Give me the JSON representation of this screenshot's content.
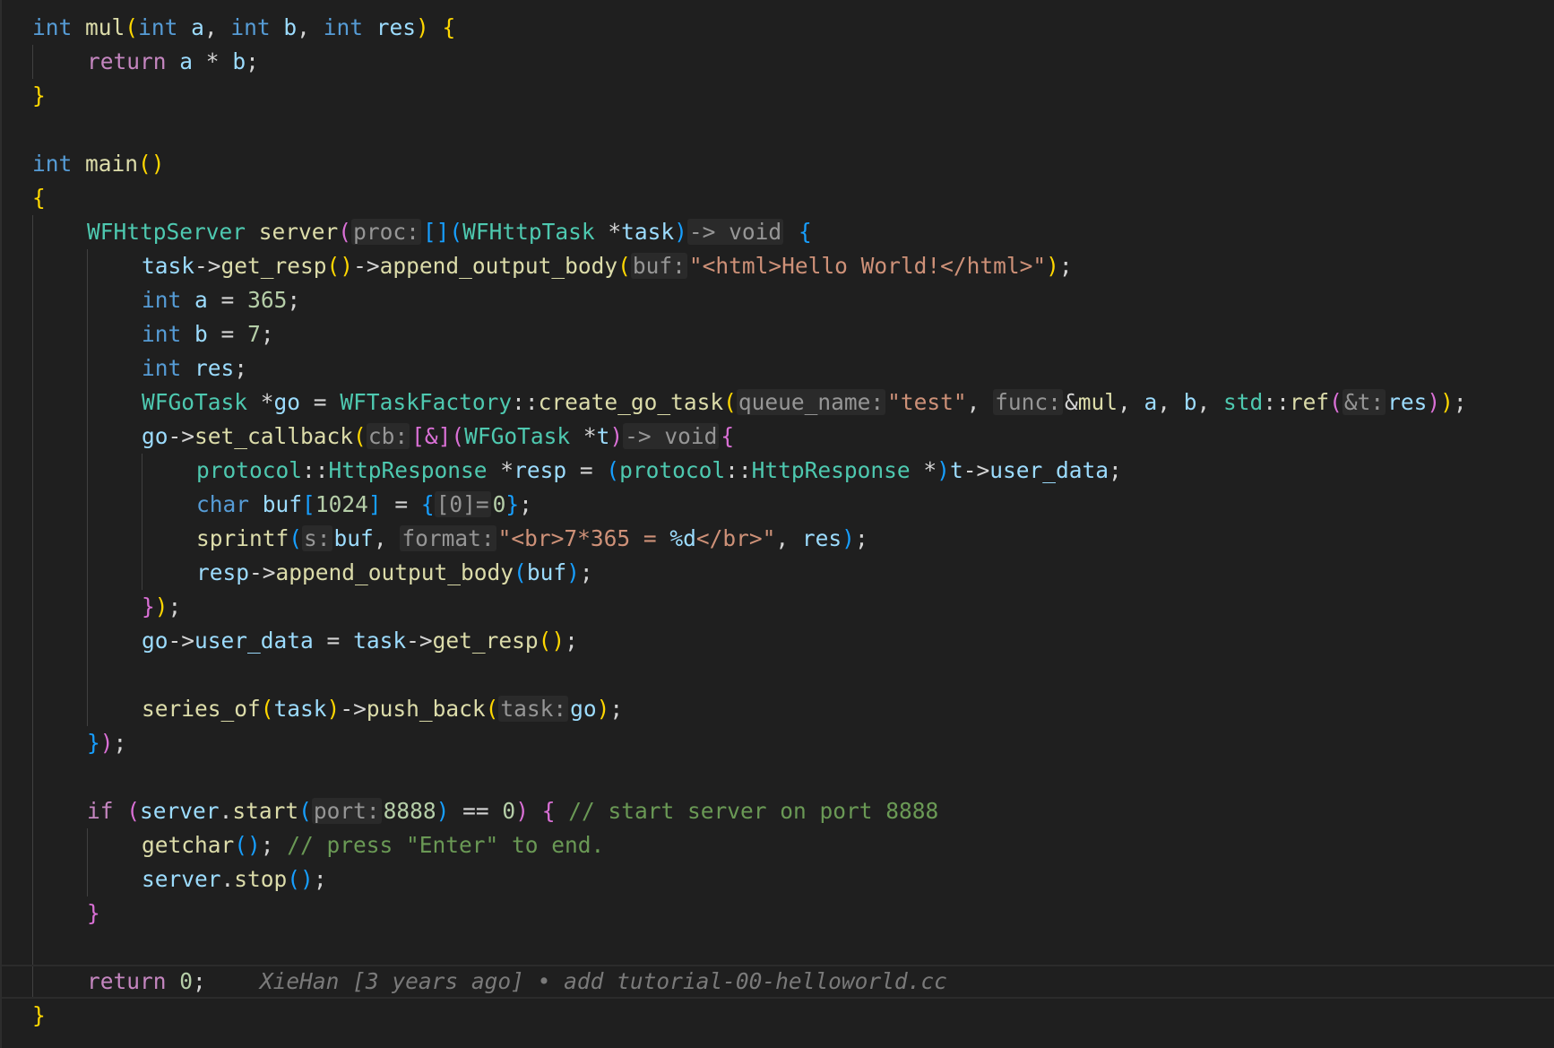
{
  "editor": {
    "language": "cpp",
    "theme_colors": {
      "background": "#1f1f1f",
      "keyword": "#569cd6",
      "control": "#c586c0",
      "function": "#dcdcaa",
      "variable": "#9cdcfe",
      "type": "#4ec9b0",
      "string": "#ce9178",
      "number": "#b5cea8",
      "comment": "#6a9955",
      "inlay_hint": "#969696"
    },
    "blame": {
      "text": "XieHan [3 years ago] • add tutorial-00-helloworld.cc",
      "line_index": 28
    },
    "lines": [
      {
        "indent": 0,
        "tokens": [
          [
            "kw",
            "int"
          ],
          [
            "op",
            " "
          ],
          [
            "fn",
            "mul"
          ],
          [
            "b1",
            "("
          ],
          [
            "kw",
            "int"
          ],
          [
            "op",
            " "
          ],
          [
            "var",
            "a"
          ],
          [
            "op",
            ", "
          ],
          [
            "kw",
            "int"
          ],
          [
            "op",
            " "
          ],
          [
            "var",
            "b"
          ],
          [
            "op",
            ", "
          ],
          [
            "kw",
            "int"
          ],
          [
            "op",
            " "
          ],
          [
            "var",
            "res"
          ],
          [
            "b1",
            ")"
          ],
          [
            "op",
            " "
          ],
          [
            "b1",
            "{"
          ]
        ]
      },
      {
        "indent": 1,
        "tokens": [
          [
            "ctl",
            "return"
          ],
          [
            "op",
            " "
          ],
          [
            "var",
            "a"
          ],
          [
            "op",
            " * "
          ],
          [
            "var",
            "b"
          ],
          [
            "op",
            ";"
          ]
        ]
      },
      {
        "indent": 0,
        "tokens": [
          [
            "b1",
            "}"
          ]
        ]
      },
      {
        "indent": 0,
        "tokens": []
      },
      {
        "indent": 0,
        "tokens": [
          [
            "kw",
            "int"
          ],
          [
            "op",
            " "
          ],
          [
            "fn",
            "main"
          ],
          [
            "b1",
            "()"
          ]
        ]
      },
      {
        "indent": 0,
        "tokens": [
          [
            "b1",
            "{"
          ]
        ]
      },
      {
        "indent": 1,
        "tokens": [
          [
            "type",
            "WFHttpServer"
          ],
          [
            "op",
            " "
          ],
          [
            "fn",
            "server"
          ],
          [
            "b2",
            "("
          ],
          [
            "hint",
            "proc:"
          ],
          [
            "b3",
            "[]("
          ],
          [
            "type",
            "WFHttpTask"
          ],
          [
            "op",
            " *"
          ],
          [
            "var",
            "task"
          ],
          [
            "b3",
            ")"
          ],
          [
            "hint",
            "-> void"
          ],
          [
            "op",
            " "
          ],
          [
            "b3",
            "{"
          ]
        ]
      },
      {
        "indent": 2,
        "tokens": [
          [
            "var",
            "task"
          ],
          [
            "op",
            "->"
          ],
          [
            "fn",
            "get_resp"
          ],
          [
            "b1",
            "()"
          ],
          [
            "op",
            "->"
          ],
          [
            "fn",
            "append_output_body"
          ],
          [
            "b1",
            "("
          ],
          [
            "hint",
            "buf:"
          ],
          [
            "str",
            "\"<html>Hello World!</html>\""
          ],
          [
            "b1",
            ")"
          ],
          [
            "op",
            ";"
          ]
        ]
      },
      {
        "indent": 2,
        "tokens": [
          [
            "kw",
            "int"
          ],
          [
            "op",
            " "
          ],
          [
            "var",
            "a"
          ],
          [
            "op",
            " = "
          ],
          [
            "num",
            "365"
          ],
          [
            "op",
            ";"
          ]
        ]
      },
      {
        "indent": 2,
        "tokens": [
          [
            "kw",
            "int"
          ],
          [
            "op",
            " "
          ],
          [
            "var",
            "b"
          ],
          [
            "op",
            " = "
          ],
          [
            "num",
            "7"
          ],
          [
            "op",
            ";"
          ]
        ]
      },
      {
        "indent": 2,
        "tokens": [
          [
            "kw",
            "int"
          ],
          [
            "op",
            " "
          ],
          [
            "var",
            "res"
          ],
          [
            "op",
            ";"
          ]
        ]
      },
      {
        "indent": 2,
        "tokens": [
          [
            "type",
            "WFGoTask"
          ],
          [
            "op",
            " *"
          ],
          [
            "var",
            "go"
          ],
          [
            "op",
            " = "
          ],
          [
            "type",
            "WFTaskFactory"
          ],
          [
            "op",
            "::"
          ],
          [
            "fn",
            "create_go_task"
          ],
          [
            "b1",
            "("
          ],
          [
            "hint",
            "queue_name:"
          ],
          [
            "str",
            "\"test\""
          ],
          [
            "op",
            ", "
          ],
          [
            "hint",
            "func:"
          ],
          [
            "op",
            "&"
          ],
          [
            "fn",
            "mul"
          ],
          [
            "op",
            ", "
          ],
          [
            "var",
            "a"
          ],
          [
            "op",
            ", "
          ],
          [
            "var",
            "b"
          ],
          [
            "op",
            ", "
          ],
          [
            "type",
            "std"
          ],
          [
            "op",
            "::"
          ],
          [
            "fn",
            "ref"
          ],
          [
            "b2",
            "("
          ],
          [
            "hint",
            "&t:"
          ],
          [
            "var",
            "res"
          ],
          [
            "b2",
            ")"
          ],
          [
            "b1",
            ")"
          ],
          [
            "op",
            ";"
          ]
        ]
      },
      {
        "indent": 2,
        "tokens": [
          [
            "var",
            "go"
          ],
          [
            "op",
            "->"
          ],
          [
            "fn",
            "set_callback"
          ],
          [
            "b1",
            "("
          ],
          [
            "hint",
            "cb:"
          ],
          [
            "b2",
            "[&]("
          ],
          [
            "type",
            "WFGoTask"
          ],
          [
            "op",
            " *"
          ],
          [
            "var",
            "t"
          ],
          [
            "b2",
            ")"
          ],
          [
            "hint",
            "-> void"
          ],
          [
            "b2",
            "{"
          ]
        ]
      },
      {
        "indent": 3,
        "tokens": [
          [
            "type",
            "protocol"
          ],
          [
            "op",
            "::"
          ],
          [
            "type",
            "HttpResponse"
          ],
          [
            "op",
            " *"
          ],
          [
            "var",
            "resp"
          ],
          [
            "op",
            " = "
          ],
          [
            "b3",
            "("
          ],
          [
            "type",
            "protocol"
          ],
          [
            "op",
            "::"
          ],
          [
            "type",
            "HttpResponse"
          ],
          [
            "op",
            " *"
          ],
          [
            "b3",
            ")"
          ],
          [
            "var",
            "t"
          ],
          [
            "op",
            "->"
          ],
          [
            "var",
            "user_data"
          ],
          [
            "op",
            ";"
          ]
        ]
      },
      {
        "indent": 3,
        "tokens": [
          [
            "kw",
            "char"
          ],
          [
            "op",
            " "
          ],
          [
            "var",
            "buf"
          ],
          [
            "b3",
            "["
          ],
          [
            "num",
            "1024"
          ],
          [
            "b3",
            "]"
          ],
          [
            "op",
            " = "
          ],
          [
            "b3",
            "{"
          ],
          [
            "hint",
            "[0]="
          ],
          [
            "num",
            "0"
          ],
          [
            "b3",
            "}"
          ],
          [
            "op",
            ";"
          ]
        ]
      },
      {
        "indent": 3,
        "tokens": [
          [
            "fn",
            "sprintf"
          ],
          [
            "b3",
            "("
          ],
          [
            "hint",
            "s:"
          ],
          [
            "var",
            "buf"
          ],
          [
            "op",
            ", "
          ],
          [
            "hint",
            "format:"
          ],
          [
            "str",
            "\"<br>7*365 = "
          ],
          [
            "var",
            "%d"
          ],
          [
            "str",
            "</br>\""
          ],
          [
            "op",
            ", "
          ],
          [
            "var",
            "res"
          ],
          [
            "b3",
            ")"
          ],
          [
            "op",
            ";"
          ]
        ]
      },
      {
        "indent": 3,
        "tokens": [
          [
            "var",
            "resp"
          ],
          [
            "op",
            "->"
          ],
          [
            "fn",
            "append_output_body"
          ],
          [
            "b3",
            "("
          ],
          [
            "var",
            "buf"
          ],
          [
            "b3",
            ")"
          ],
          [
            "op",
            ";"
          ]
        ]
      },
      {
        "indent": 2,
        "tokens": [
          [
            "b2",
            "}"
          ],
          [
            "b1",
            ")"
          ],
          [
            "op",
            ";"
          ]
        ]
      },
      {
        "indent": 2,
        "tokens": [
          [
            "var",
            "go"
          ],
          [
            "op",
            "->"
          ],
          [
            "var",
            "user_data"
          ],
          [
            "op",
            " = "
          ],
          [
            "var",
            "task"
          ],
          [
            "op",
            "->"
          ],
          [
            "fn",
            "get_resp"
          ],
          [
            "b1",
            "()"
          ],
          [
            "op",
            ";"
          ]
        ]
      },
      {
        "indent": 2,
        "tokens": []
      },
      {
        "indent": 2,
        "tokens": [
          [
            "fn",
            "series_of"
          ],
          [
            "b1",
            "("
          ],
          [
            "var",
            "task"
          ],
          [
            "b1",
            ")"
          ],
          [
            "op",
            "->"
          ],
          [
            "fn",
            "push_back"
          ],
          [
            "b1",
            "("
          ],
          [
            "hint",
            "task:"
          ],
          [
            "var",
            "go"
          ],
          [
            "b1",
            ")"
          ],
          [
            "op",
            ";"
          ]
        ]
      },
      {
        "indent": 1,
        "tokens": [
          [
            "b3",
            "}"
          ],
          [
            "b2",
            ")"
          ],
          [
            "op",
            ";"
          ]
        ]
      },
      {
        "indent": 1,
        "tokens": []
      },
      {
        "indent": 1,
        "tokens": [
          [
            "ctl",
            "if"
          ],
          [
            "op",
            " "
          ],
          [
            "b2",
            "("
          ],
          [
            "var",
            "server"
          ],
          [
            "op",
            "."
          ],
          [
            "fn",
            "start"
          ],
          [
            "b3",
            "("
          ],
          [
            "hint",
            "port:"
          ],
          [
            "num",
            "8888"
          ],
          [
            "b3",
            ")"
          ],
          [
            "op",
            " == "
          ],
          [
            "num",
            "0"
          ],
          [
            "b2",
            ")"
          ],
          [
            "op",
            " "
          ],
          [
            "b2",
            "{"
          ],
          [
            "op",
            " "
          ],
          [
            "cmt",
            "// start server on port 8888"
          ]
        ]
      },
      {
        "indent": 2,
        "tokens": [
          [
            "fn",
            "getchar"
          ],
          [
            "b3",
            "()"
          ],
          [
            "op",
            "; "
          ],
          [
            "cmt",
            "// press \"Enter\" to end."
          ]
        ]
      },
      {
        "indent": 2,
        "tokens": [
          [
            "var",
            "server"
          ],
          [
            "op",
            "."
          ],
          [
            "fn",
            "stop"
          ],
          [
            "b3",
            "()"
          ],
          [
            "op",
            ";"
          ]
        ]
      },
      {
        "indent": 1,
        "tokens": [
          [
            "b2",
            "}"
          ]
        ]
      },
      {
        "indent": 1,
        "tokens": []
      },
      {
        "indent": 1,
        "tokens": [
          [
            "ctl",
            "return"
          ],
          [
            "op",
            " "
          ],
          [
            "num",
            "0"
          ],
          [
            "op",
            ";"
          ]
        ]
      },
      {
        "indent": 0,
        "tokens": [
          [
            "b1",
            "}"
          ]
        ]
      }
    ]
  }
}
